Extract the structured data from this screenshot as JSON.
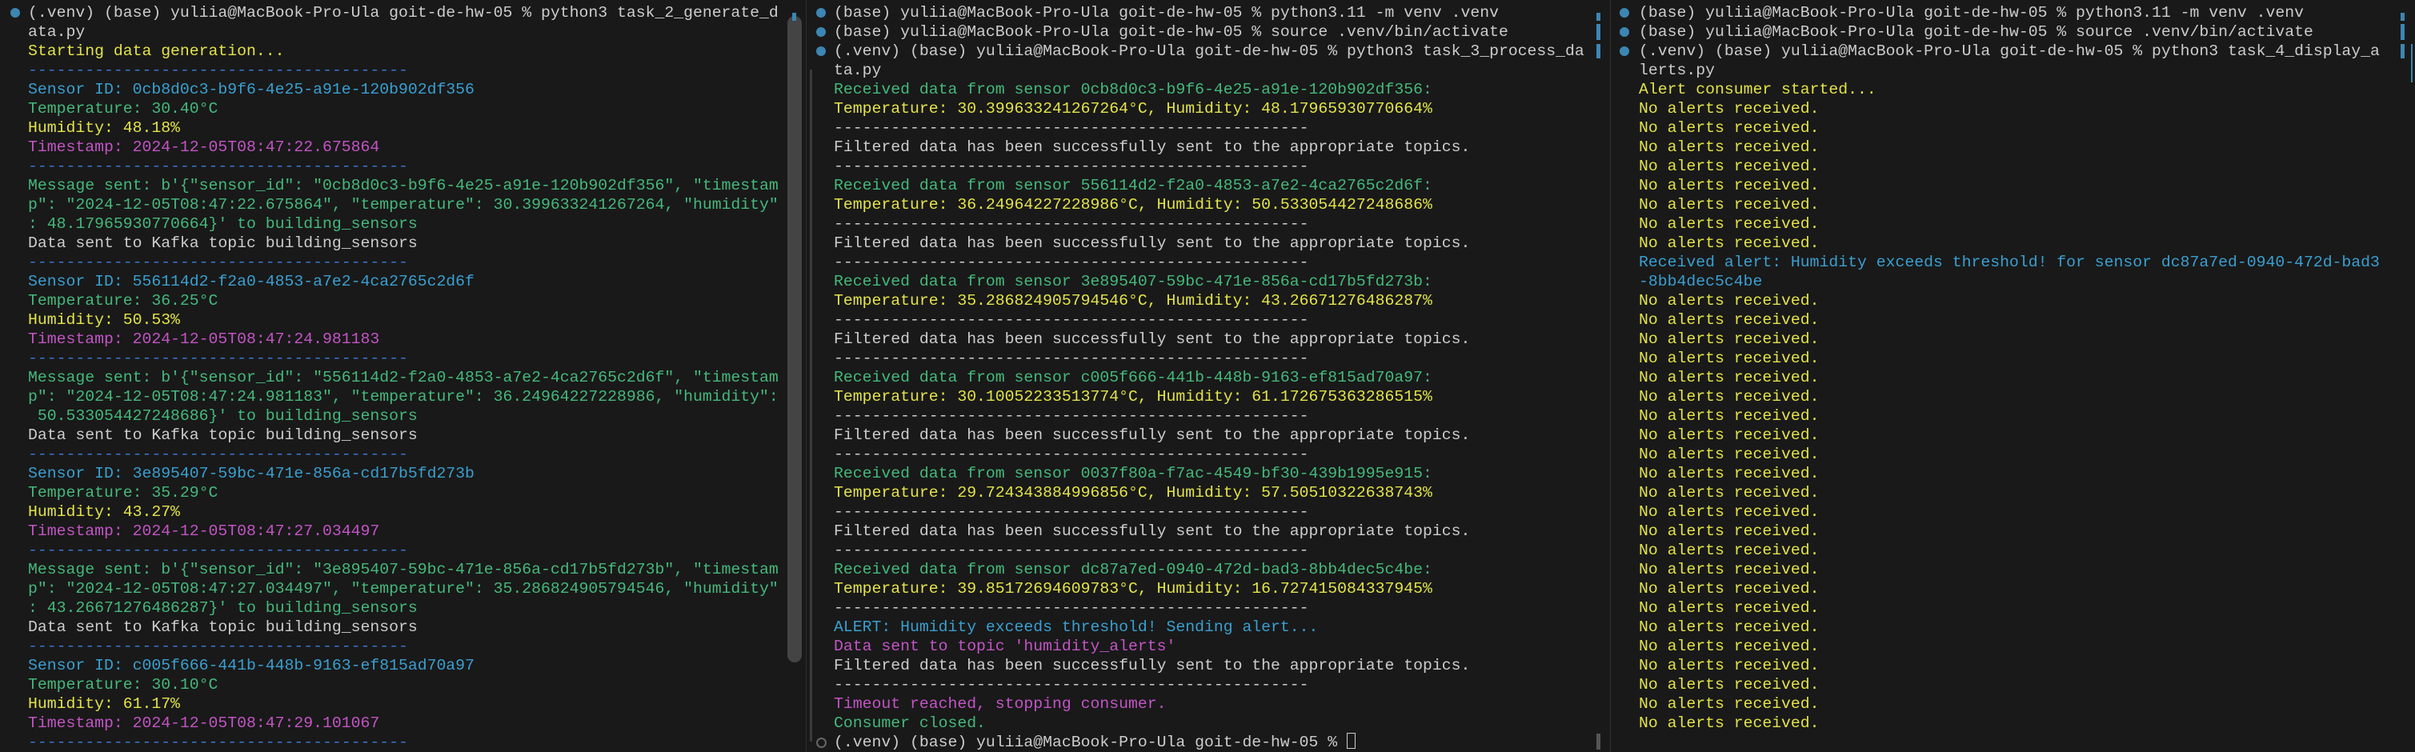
{
  "colors": {
    "background": "#191919",
    "text": "#cccccc",
    "yellow": "#e3e34a",
    "green": "#45b87b",
    "cyan": "#3a9fd0",
    "magenta": "#c254c5",
    "blue": "#3b74cc",
    "bullet": "#3c86b3"
  },
  "panels": [
    {
      "name": "terminal-generate-data",
      "lines": [
        {
          "text": "(.venv) (base) yuliia@MacBook-Pro-Ula goit-de-hw-05 % python3 task_2_generate_d",
          "color": "white",
          "prompt": true
        },
        {
          "text": "ata.py",
          "color": "white"
        },
        {
          "text": "Starting data generation...",
          "color": "yellow"
        },
        {
          "text": "----------------------------------------",
          "color": "blue"
        },
        {
          "text": "Sensor ID: 0cb8d0c3-b9f6-4e25-a91e-120b902df356",
          "color": "cyan"
        },
        {
          "text": "Temperature: 30.40°C",
          "color": "green"
        },
        {
          "text": "Humidity: 48.18%",
          "color": "yellow"
        },
        {
          "text": "Timestamp: 2024-12-05T08:47:22.675864",
          "color": "magenta"
        },
        {
          "text": "----------------------------------------",
          "color": "blue"
        },
        {
          "text": "Message sent: b'{\"sensor_id\": \"0cb8d0c3-b9f6-4e25-a91e-120b902df356\", \"timestam",
          "color": "green"
        },
        {
          "text": "p\": \"2024-12-05T08:47:22.675864\", \"temperature\": 30.399633241267264, \"humidity\"",
          "color": "green"
        },
        {
          "text": ": 48.17965930770664}' to building_sensors",
          "color": "green"
        },
        {
          "text": "Data sent to Kafka topic building_sensors",
          "color": "white"
        },
        {
          "text": "----------------------------------------",
          "color": "blue"
        },
        {
          "text": "Sensor ID: 556114d2-f2a0-4853-a7e2-4ca2765c2d6f",
          "color": "cyan"
        },
        {
          "text": "Temperature: 36.25°C",
          "color": "green"
        },
        {
          "text": "Humidity: 50.53%",
          "color": "yellow"
        },
        {
          "text": "Timestamp: 2024-12-05T08:47:24.981183",
          "color": "magenta"
        },
        {
          "text": "----------------------------------------",
          "color": "blue"
        },
        {
          "text": "Message sent: b'{\"sensor_id\": \"556114d2-f2a0-4853-a7e2-4ca2765c2d6f\", \"timestam",
          "color": "green"
        },
        {
          "text": "p\": \"2024-12-05T08:47:24.981183\", \"temperature\": 36.24964227228986, \"humidity\":",
          "color": "green"
        },
        {
          "text": " 50.533054427248686}' to building_sensors",
          "color": "green"
        },
        {
          "text": "Data sent to Kafka topic building_sensors",
          "color": "white"
        },
        {
          "text": "----------------------------------------",
          "color": "blue"
        },
        {
          "text": "Sensor ID: 3e895407-59bc-471e-856a-cd17b5fd273b",
          "color": "cyan"
        },
        {
          "text": "Temperature: 35.29°C",
          "color": "green"
        },
        {
          "text": "Humidity: 43.27%",
          "color": "yellow"
        },
        {
          "text": "Timestamp: 2024-12-05T08:47:27.034497",
          "color": "magenta"
        },
        {
          "text": "----------------------------------------",
          "color": "blue"
        },
        {
          "text": "Message sent: b'{\"sensor_id\": \"3e895407-59bc-471e-856a-cd17b5fd273b\", \"timestam",
          "color": "green"
        },
        {
          "text": "p\": \"2024-12-05T08:47:27.034497\", \"temperature\": 35.286824905794546, \"humidity\"",
          "color": "green"
        },
        {
          "text": ": 43.26671276486287}' to building_sensors",
          "color": "green"
        },
        {
          "text": "Data sent to Kafka topic building_sensors",
          "color": "white"
        },
        {
          "text": "----------------------------------------",
          "color": "blue"
        },
        {
          "text": "Sensor ID: c005f666-441b-448b-9163-ef815ad70a97",
          "color": "cyan"
        },
        {
          "text": "Temperature: 30.10°C",
          "color": "green"
        },
        {
          "text": "Humidity: 61.17%",
          "color": "yellow"
        },
        {
          "text": "Timestamp: 2024-12-05T08:47:29.101067",
          "color": "magenta"
        },
        {
          "text": "----------------------------------------",
          "color": "blue"
        }
      ]
    },
    {
      "name": "terminal-process-data",
      "lines": [
        {
          "text": "(base) yuliia@MacBook-Pro-Ula goit-de-hw-05 % python3.11 -m venv .venv",
          "color": "white",
          "prompt": true
        },
        {
          "text": "(base) yuliia@MacBook-Pro-Ula goit-de-hw-05 % source .venv/bin/activate",
          "color": "white",
          "prompt": true
        },
        {
          "text": "(.venv) (base) yuliia@MacBook-Pro-Ula goit-de-hw-05 % python3 task_3_process_da",
          "color": "white",
          "prompt": true
        },
        {
          "text": "ta.py",
          "color": "white"
        },
        {
          "text": "Received data from sensor 0cb8d0c3-b9f6-4e25-a91e-120b902df356:",
          "color": "green"
        },
        {
          "text": "Temperature: 30.399633241267264°C, Humidity: 48.17965930770664%",
          "color": "yellow"
        },
        {
          "text": "--------------------------------------------------",
          "color": "white"
        },
        {
          "text": "Filtered data has been successfully sent to the appropriate topics.",
          "color": "white"
        },
        {
          "text": "--------------------------------------------------",
          "color": "white"
        },
        {
          "text": "Received data from sensor 556114d2-f2a0-4853-a7e2-4ca2765c2d6f:",
          "color": "green"
        },
        {
          "text": "Temperature: 36.24964227228986°C, Humidity: 50.533054427248686%",
          "color": "yellow"
        },
        {
          "text": "--------------------------------------------------",
          "color": "white"
        },
        {
          "text": "Filtered data has been successfully sent to the appropriate topics.",
          "color": "white"
        },
        {
          "text": "--------------------------------------------------",
          "color": "white"
        },
        {
          "text": "Received data from sensor 3e895407-59bc-471e-856a-cd17b5fd273b:",
          "color": "green"
        },
        {
          "text": "Temperature: 35.286824905794546°C, Humidity: 43.26671276486287%",
          "color": "yellow"
        },
        {
          "text": "--------------------------------------------------",
          "color": "white"
        },
        {
          "text": "Filtered data has been successfully sent to the appropriate topics.",
          "color": "white"
        },
        {
          "text": "--------------------------------------------------",
          "color": "white"
        },
        {
          "text": "Received data from sensor c005f666-441b-448b-9163-ef815ad70a97:",
          "color": "green"
        },
        {
          "text": "Temperature: 30.10052233513774°C, Humidity: 61.172675363286515%",
          "color": "yellow"
        },
        {
          "text": "--------------------------------------------------",
          "color": "white"
        },
        {
          "text": "Filtered data has been successfully sent to the appropriate topics.",
          "color": "white"
        },
        {
          "text": "--------------------------------------------------",
          "color": "white"
        },
        {
          "text": "Received data from sensor 0037f80a-f7ac-4549-bf30-439b1995e915:",
          "color": "green"
        },
        {
          "text": "Temperature: 29.724343884996856°C, Humidity: 57.50510322638743%",
          "color": "yellow"
        },
        {
          "text": "--------------------------------------------------",
          "color": "white"
        },
        {
          "text": "Filtered data has been successfully sent to the appropriate topics.",
          "color": "white"
        },
        {
          "text": "--------------------------------------------------",
          "color": "white"
        },
        {
          "text": "Received data from sensor dc87a7ed-0940-472d-bad3-8bb4dec5c4be:",
          "color": "green"
        },
        {
          "text": "Temperature: 39.85172694609783°C, Humidity: 16.727415084337945%",
          "color": "yellow"
        },
        {
          "text": "--------------------------------------------------",
          "color": "white"
        },
        {
          "text": "ALERT: Humidity exceeds threshold! Sending alert...",
          "color": "cyan"
        },
        {
          "text": "Data sent to topic 'humidity_alerts'",
          "color": "magenta"
        },
        {
          "text": "Filtered data has been successfully sent to the appropriate topics.",
          "color": "white"
        },
        {
          "text": "--------------------------------------------------",
          "color": "white"
        },
        {
          "text": "Timeout reached, stopping consumer.",
          "color": "magenta"
        },
        {
          "text": "Consumer closed.",
          "color": "green"
        },
        {
          "text": "(.venv) (base) yuliia@MacBook-Pro-Ula goit-de-hw-05 % ",
          "color": "white",
          "prompt": true,
          "active": true
        }
      ]
    },
    {
      "name": "terminal-display-alerts",
      "lines": [
        {
          "text": "(base) yuliia@MacBook-Pro-Ula goit-de-hw-05 % python3.11 -m venv .venv",
          "color": "white",
          "prompt": true
        },
        {
          "text": "(base) yuliia@MacBook-Pro-Ula goit-de-hw-05 % source .venv/bin/activate",
          "color": "white",
          "prompt": true
        },
        {
          "text": "(.venv) (base) yuliia@MacBook-Pro-Ula goit-de-hw-05 % python3 task_4_display_a",
          "color": "white",
          "prompt": true
        },
        {
          "text": "lerts.py",
          "color": "white"
        },
        {
          "text": "Alert consumer started...",
          "color": "yellow"
        },
        {
          "text": "No alerts received.",
          "color": "yellow"
        },
        {
          "text": "No alerts received.",
          "color": "yellow"
        },
        {
          "text": "No alerts received.",
          "color": "yellow"
        },
        {
          "text": "No alerts received.",
          "color": "yellow"
        },
        {
          "text": "No alerts received.",
          "color": "yellow"
        },
        {
          "text": "No alerts received.",
          "color": "yellow"
        },
        {
          "text": "No alerts received.",
          "color": "yellow"
        },
        {
          "text": "No alerts received.",
          "color": "yellow"
        },
        {
          "text": "Received alert: Humidity exceeds threshold! for sensor dc87a7ed-0940-472d-bad3",
          "color": "cyan"
        },
        {
          "text": "-8bb4dec5c4be",
          "color": "cyan"
        },
        {
          "text": "No alerts received.",
          "color": "yellow"
        },
        {
          "text": "No alerts received.",
          "color": "yellow"
        },
        {
          "text": "No alerts received.",
          "color": "yellow"
        },
        {
          "text": "No alerts received.",
          "color": "yellow"
        },
        {
          "text": "No alerts received.",
          "color": "yellow"
        },
        {
          "text": "No alerts received.",
          "color": "yellow"
        },
        {
          "text": "No alerts received.",
          "color": "yellow"
        },
        {
          "text": "No alerts received.",
          "color": "yellow"
        },
        {
          "text": "No alerts received.",
          "color": "yellow"
        },
        {
          "text": "No alerts received.",
          "color": "yellow"
        },
        {
          "text": "No alerts received.",
          "color": "yellow"
        },
        {
          "text": "No alerts received.",
          "color": "yellow"
        },
        {
          "text": "No alerts received.",
          "color": "yellow"
        },
        {
          "text": "No alerts received.",
          "color": "yellow"
        },
        {
          "text": "No alerts received.",
          "color": "yellow"
        },
        {
          "text": "No alerts received.",
          "color": "yellow"
        },
        {
          "text": "No alerts received.",
          "color": "yellow"
        },
        {
          "text": "No alerts received.",
          "color": "yellow"
        },
        {
          "text": "No alerts received.",
          "color": "yellow"
        },
        {
          "text": "No alerts received.",
          "color": "yellow"
        },
        {
          "text": "No alerts received.",
          "color": "yellow"
        },
        {
          "text": "No alerts received.",
          "color": "yellow"
        },
        {
          "text": "No alerts received.",
          "color": "yellow"
        }
      ]
    }
  ]
}
